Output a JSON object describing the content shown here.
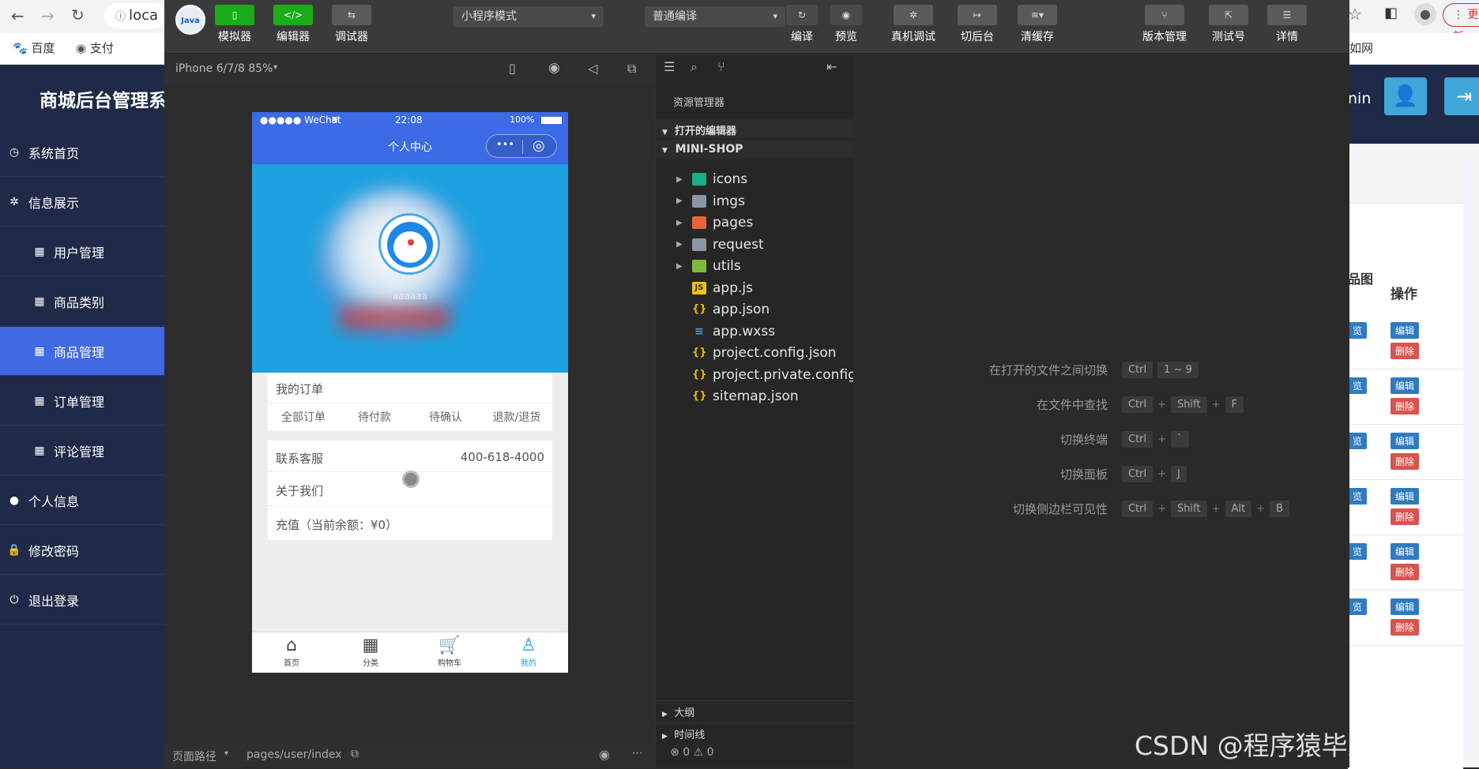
{
  "browser": {
    "address_text": "loca",
    "bookmarks": [
      "百度",
      "支付"
    ],
    "update_label": "更新"
  },
  "admin": {
    "title": "商城后台管理系",
    "menu": [
      {
        "label": "系统首页",
        "icon": "dashboard-icon"
      },
      {
        "label": "信息展示",
        "icon": "apps-icon"
      },
      {
        "label": "用户管理",
        "icon": "table-icon",
        "sub": true
      },
      {
        "label": "商品类别",
        "icon": "table-icon",
        "sub": true
      },
      {
        "label": "商品管理",
        "icon": "table-icon",
        "sub": true,
        "active": true
      },
      {
        "label": "订单管理",
        "icon": "table-icon",
        "sub": true
      },
      {
        "label": "评论管理",
        "icon": "table-icon",
        "sub": true
      },
      {
        "label": "个人信息",
        "icon": "user-icon"
      },
      {
        "label": "修改密码",
        "icon": "lock-icon"
      },
      {
        "label": "退出登录",
        "icon": "power-icon"
      }
    ],
    "header_right_text": "nin",
    "bookmark_tail": "如网",
    "table_head_col1": "品图",
    "table_head_ops": "操作",
    "preview_label": "览",
    "edit_label": "编辑",
    "delete_label": "删除",
    "row_count": 6
  },
  "toolbar": {
    "simulator": "模拟器",
    "editor": "编辑器",
    "debugger": "调试器",
    "mode_select": "小程序模式",
    "compile_select": "普通编译",
    "compile": "编译",
    "preview": "预览",
    "real_debug": "真机调试",
    "background": "切后台",
    "clear_cache": "清缓存",
    "version": "版本管理",
    "test_id": "测试号",
    "details": "详情"
  },
  "simulator": {
    "device": "iPhone 6/7/8 85%",
    "status_left": "●●●●● WeChat",
    "status_time": "22:08",
    "status_battery": "100%",
    "nav_title": "个人中心",
    "username": "aaaaaa",
    "orders_title": "我的订单",
    "order_tabs": [
      "全部订单",
      "待付款",
      "待确认",
      "退款/退货"
    ],
    "service_label": "联系客服",
    "service_phone": "400-618-4000",
    "about_label": "关于我们",
    "recharge_label": "充值（当前余额：¥0）",
    "tabbar": [
      {
        "label": "首页",
        "icon": "home-icon"
      },
      {
        "label": "分类",
        "icon": "grid-icon"
      },
      {
        "label": "购物车",
        "icon": "cart-icon"
      },
      {
        "label": "我的",
        "icon": "person-icon",
        "active": true
      }
    ],
    "page_path_label": "页面路径",
    "page_path": "pages/user/index"
  },
  "explorer": {
    "title": "资源管理器",
    "open_editors": "打开的编辑器",
    "project": "MINI-SHOP",
    "items": [
      {
        "name": "icons",
        "type": "folder",
        "color": "#1aad8a"
      },
      {
        "name": "imgs",
        "type": "folder",
        "color": "#8a96a3"
      },
      {
        "name": "pages",
        "type": "folder",
        "color": "#e8643c"
      },
      {
        "name": "request",
        "type": "folder",
        "color": "#8a96a3"
      },
      {
        "name": "utils",
        "type": "folder",
        "color": "#7fba3c"
      },
      {
        "name": "app.js",
        "type": "js"
      },
      {
        "name": "app.json",
        "type": "json"
      },
      {
        "name": "app.wxss",
        "type": "wxss"
      },
      {
        "name": "project.config.json",
        "type": "json"
      },
      {
        "name": "project.private.config...",
        "type": "json"
      },
      {
        "name": "sitemap.json",
        "type": "json"
      }
    ],
    "outline": "大纲",
    "timeline": "时间线",
    "status_errors": "0",
    "status_warnings": "0"
  },
  "shortcuts": [
    {
      "label": "在打开的文件之间切换",
      "keys": [
        "Ctrl",
        "1 ~ 9"
      ]
    },
    {
      "label": "在文件中查找",
      "keys": [
        "Ctrl",
        "+",
        "Shift",
        "+",
        "F"
      ]
    },
    {
      "label": "切换终端",
      "keys": [
        "Ctrl",
        "+",
        "`"
      ]
    },
    {
      "label": "切换面板",
      "keys": [
        "Ctrl",
        "+",
        "J"
      ]
    },
    {
      "label": "切换侧边栏可见性",
      "keys": [
        "Ctrl",
        "+",
        "Shift",
        "+",
        "Alt",
        "+",
        "B"
      ]
    }
  ],
  "watermark": "CSDN @程序猿毕业分享网",
  "colors": {
    "active_blue": "#4169e1",
    "green": "#1aad19",
    "edit_btn": "#2f7bc2",
    "delete_btn": "#d9534f"
  }
}
